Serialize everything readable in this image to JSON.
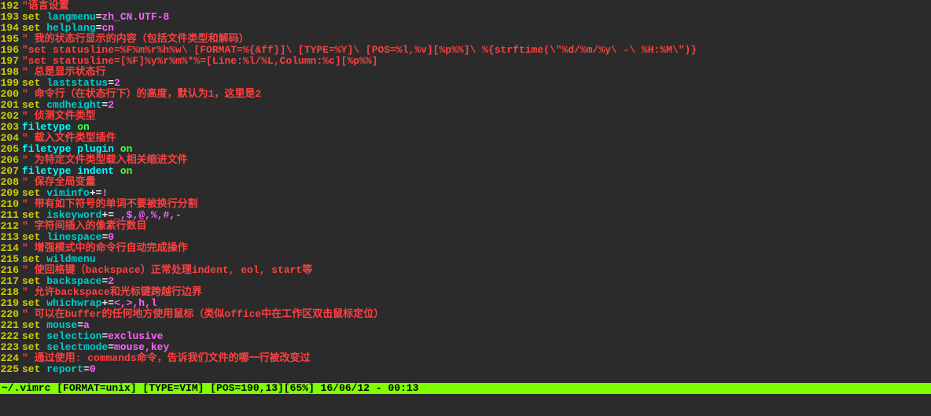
{
  "lines": [
    {
      "n": "192",
      "seg": [
        {
          "c": "c-red",
          "t": "\"语言设置"
        }
      ]
    },
    {
      "n": "193",
      "seg": [
        {
          "c": "c-yellow",
          "t": "set"
        },
        {
          "c": "",
          "t": " "
        },
        {
          "c": "c-cyan",
          "t": "langmenu"
        },
        {
          "c": "c-white",
          "t": "="
        },
        {
          "c": "c-mag",
          "t": "zh_CN.UTF-8"
        }
      ]
    },
    {
      "n": "194",
      "seg": [
        {
          "c": "c-yellow",
          "t": "set"
        },
        {
          "c": "",
          "t": " "
        },
        {
          "c": "c-cyan",
          "t": "helplang"
        },
        {
          "c": "c-white",
          "t": "="
        },
        {
          "c": "c-mag",
          "t": "cn"
        }
      ]
    },
    {
      "n": "195",
      "seg": [
        {
          "c": "c-red",
          "t": "\" 我的状态行显示的内容（包括文件类型和解码）"
        }
      ]
    },
    {
      "n": "196",
      "seg": [
        {
          "c": "c-red",
          "t": "\"set statusline=%F%m%r%h%w\\ [FORMAT=%{&ff}]\\ [TYPE=%Y]\\ [POS=%l,%v][%p%%]\\ %{strftime(\\\"%d/%m/%y\\ -\\ %H:%M\\\")}"
        }
      ]
    },
    {
      "n": "197",
      "seg": [
        {
          "c": "c-red",
          "t": "\"set statusline=[%F]%y%r%m%*%=[Line:%l/%L,Column:%c][%p%%]"
        }
      ]
    },
    {
      "n": "198",
      "seg": [
        {
          "c": "c-red",
          "t": "\" 总是显示状态行"
        }
      ]
    },
    {
      "n": "199",
      "seg": [
        {
          "c": "c-yellow",
          "t": "set"
        },
        {
          "c": "",
          "t": " "
        },
        {
          "c": "c-cyan",
          "t": "laststatus"
        },
        {
          "c": "c-white",
          "t": "="
        },
        {
          "c": "c-mag",
          "t": "2"
        }
      ]
    },
    {
      "n": "200",
      "seg": [
        {
          "c": "c-red",
          "t": "\" 命令行（在状态行下）的高度，默认为1，这里是2"
        }
      ]
    },
    {
      "n": "201",
      "seg": [
        {
          "c": "c-yellow",
          "t": "set"
        },
        {
          "c": "",
          "t": " "
        },
        {
          "c": "c-cyan",
          "t": "cmdheight"
        },
        {
          "c": "c-white",
          "t": "="
        },
        {
          "c": "c-mag",
          "t": "2"
        }
      ]
    },
    {
      "n": "202",
      "seg": [
        {
          "c": "c-red",
          "t": "\" 侦测文件类型"
        }
      ]
    },
    {
      "n": "203",
      "seg": [
        {
          "c": "c-cyan-b",
          "t": "filetype"
        },
        {
          "c": "",
          "t": " "
        },
        {
          "c": "c-green",
          "t": "on"
        }
      ]
    },
    {
      "n": "204",
      "seg": [
        {
          "c": "c-red",
          "t": "\" 载入文件类型插件"
        }
      ]
    },
    {
      "n": "205",
      "seg": [
        {
          "c": "c-cyan-b",
          "t": "filetype"
        },
        {
          "c": "",
          "t": " "
        },
        {
          "c": "c-cyan-b",
          "t": "plugin"
        },
        {
          "c": "",
          "t": " "
        },
        {
          "c": "c-green",
          "t": "on"
        }
      ]
    },
    {
      "n": "206",
      "seg": [
        {
          "c": "c-red",
          "t": "\" 为特定文件类型载入相关缩进文件"
        }
      ]
    },
    {
      "n": "207",
      "seg": [
        {
          "c": "c-cyan-b",
          "t": "filetype"
        },
        {
          "c": "",
          "t": " "
        },
        {
          "c": "c-cyan-b",
          "t": "indent"
        },
        {
          "c": "",
          "t": " "
        },
        {
          "c": "c-green",
          "t": "on"
        }
      ]
    },
    {
      "n": "208",
      "seg": [
        {
          "c": "c-red",
          "t": "\" 保存全局变量"
        }
      ]
    },
    {
      "n": "209",
      "seg": [
        {
          "c": "c-yellow",
          "t": "set"
        },
        {
          "c": "",
          "t": " "
        },
        {
          "c": "c-cyan",
          "t": "viminfo"
        },
        {
          "c": "c-white",
          "t": "+="
        },
        {
          "c": "c-mag",
          "t": "!"
        }
      ]
    },
    {
      "n": "210",
      "seg": [
        {
          "c": "c-red",
          "t": "\" 带有如下符号的单词不要被换行分割"
        }
      ]
    },
    {
      "n": "211",
      "seg": [
        {
          "c": "c-yellow",
          "t": "set"
        },
        {
          "c": "",
          "t": " "
        },
        {
          "c": "c-cyan",
          "t": "iskeyword"
        },
        {
          "c": "c-white",
          "t": "+="
        },
        {
          "c": "c-mag",
          "t": "_,$,@,%,#,-"
        }
      ]
    },
    {
      "n": "212",
      "seg": [
        {
          "c": "c-red",
          "t": "\" 字符间插入的像素行数目"
        }
      ]
    },
    {
      "n": "213",
      "seg": [
        {
          "c": "c-yellow",
          "t": "set"
        },
        {
          "c": "",
          "t": " "
        },
        {
          "c": "c-cyan",
          "t": "linespace"
        },
        {
          "c": "c-white",
          "t": "="
        },
        {
          "c": "c-mag",
          "t": "0"
        }
      ]
    },
    {
      "n": "214",
      "seg": [
        {
          "c": "c-red",
          "t": "\" 增强模式中的命令行自动完成操作"
        }
      ]
    },
    {
      "n": "215",
      "seg": [
        {
          "c": "c-yellow",
          "t": "set"
        },
        {
          "c": "",
          "t": " "
        },
        {
          "c": "c-cyan",
          "t": "wildmenu"
        }
      ]
    },
    {
      "n": "216",
      "seg": [
        {
          "c": "c-red",
          "t": "\" 使回格键（backspace）正常处理indent, eol, start等"
        }
      ]
    },
    {
      "n": "217",
      "seg": [
        {
          "c": "c-yellow",
          "t": "set"
        },
        {
          "c": "",
          "t": " "
        },
        {
          "c": "c-cyan",
          "t": "backspace"
        },
        {
          "c": "c-white",
          "t": "="
        },
        {
          "c": "c-mag",
          "t": "2"
        }
      ]
    },
    {
      "n": "218",
      "seg": [
        {
          "c": "c-red",
          "t": "\" 允许backspace和光标键跨越行边界"
        }
      ]
    },
    {
      "n": "219",
      "seg": [
        {
          "c": "c-yellow",
          "t": "set"
        },
        {
          "c": "",
          "t": " "
        },
        {
          "c": "c-cyan",
          "t": "whichwrap"
        },
        {
          "c": "c-white",
          "t": "+="
        },
        {
          "c": "c-mag",
          "t": "<,>,h,l"
        }
      ]
    },
    {
      "n": "220",
      "seg": [
        {
          "c": "c-red",
          "t": "\" 可以在buffer的任何地方使用鼠标（类似office中在工作区双击鼠标定位）"
        }
      ]
    },
    {
      "n": "221",
      "seg": [
        {
          "c": "c-yellow",
          "t": "set"
        },
        {
          "c": "",
          "t": " "
        },
        {
          "c": "c-cyan",
          "t": "mouse"
        },
        {
          "c": "c-white",
          "t": "="
        },
        {
          "c": "c-mag",
          "t": "a"
        }
      ]
    },
    {
      "n": "222",
      "seg": [
        {
          "c": "c-yellow",
          "t": "set"
        },
        {
          "c": "",
          "t": " "
        },
        {
          "c": "c-cyan",
          "t": "selection"
        },
        {
          "c": "c-white",
          "t": "="
        },
        {
          "c": "c-mag",
          "t": "exclusive"
        }
      ]
    },
    {
      "n": "223",
      "seg": [
        {
          "c": "c-yellow",
          "t": "set"
        },
        {
          "c": "",
          "t": " "
        },
        {
          "c": "c-cyan",
          "t": "selectmode"
        },
        {
          "c": "c-white",
          "t": "="
        },
        {
          "c": "c-mag",
          "t": "mouse,key"
        }
      ]
    },
    {
      "n": "224",
      "seg": [
        {
          "c": "c-red",
          "t": "\" 通过使用: commands命令，告诉我们文件的哪一行被改变过"
        }
      ]
    },
    {
      "n": "225",
      "seg": [
        {
          "c": "c-yellow",
          "t": "set"
        },
        {
          "c": "",
          "t": " "
        },
        {
          "c": "c-cyan",
          "t": "report"
        },
        {
          "c": "c-white",
          "t": "="
        },
        {
          "c": "c-mag",
          "t": "0"
        }
      ]
    }
  ],
  "statusline": "~/.vimrc [FORMAT=unix] [TYPE=VIM] [POS=190,13][65%] 16/06/12 - 00:13"
}
